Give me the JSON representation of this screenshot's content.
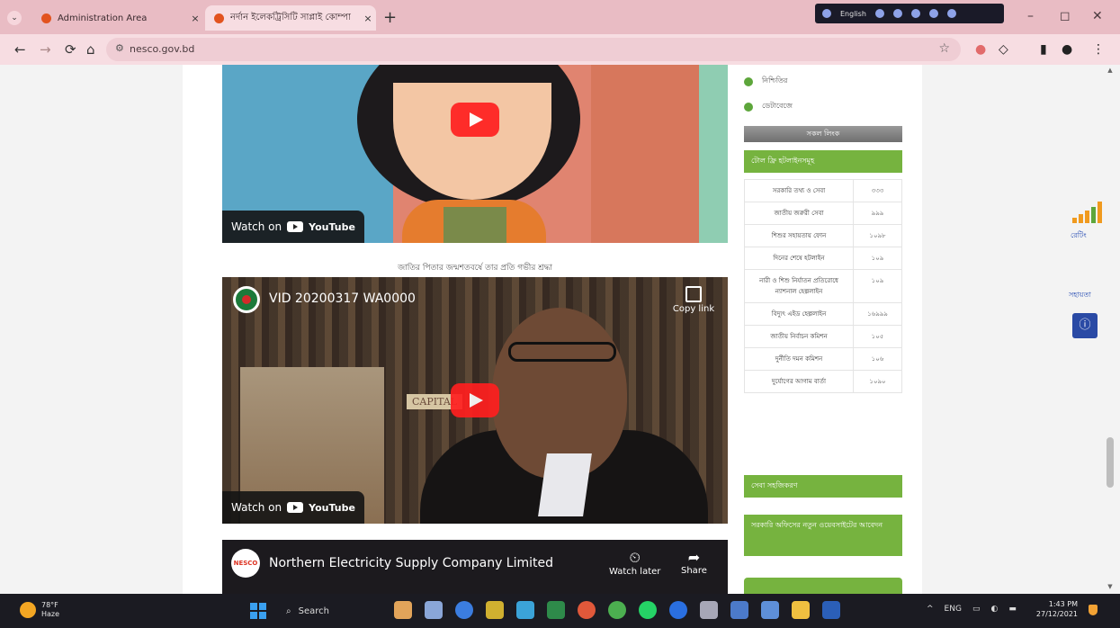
{
  "browser": {
    "tabs": [
      {
        "title": "Administration Area",
        "active": false
      },
      {
        "title": "নর্দান ইলেকট্রিসিটি সাপ্লাই কোম্পা",
        "active": true
      }
    ],
    "tab_close": "×",
    "new_tab": "+",
    "url": "nesco.gov.bd",
    "overlay_lang": "English"
  },
  "videos": [
    {
      "watch_on": "Watch on",
      "youtube": "YouTube",
      "caption": "জাতির পিতার জন্মশতবর্ষে তার প্রতি গভীর শ্রদ্ধা"
    },
    {
      "title": "VID 20200317 WA0000",
      "copy_link": "Copy link",
      "shelf_book": "CAPITAL",
      "watch_on": "Watch on",
      "youtube": "YouTube"
    },
    {
      "channel_logo_text": "NESCO",
      "title": "Northern Electricity Supply Company Limited",
      "watch_later": "Watch later",
      "share": "Share"
    }
  ],
  "sidebar": {
    "links": [
      "নিশ্চিতির",
      "ডেটাবেজে"
    ],
    "more_button": "সকল লিংক",
    "hotline_header": "টোল ফ্রি হটলাইনসমূহ",
    "hotlines": [
      {
        "name": "সরকারি তথ্য ও সেবা",
        "number": "৩৩৩"
      },
      {
        "name": "জাতীয় জরুরী সেবা",
        "number": "৯৯৯"
      },
      {
        "name": "শিশুর সহায়তায় ফোন",
        "number": "১০৯৮"
      },
      {
        "name": "দিনের শেষে হটলাইন",
        "number": "১০৯"
      },
      {
        "name": "নারী ও শিশু নির্যাতন প্রতিরোধে ন্যাশনাল হেল্পলাইন",
        "number": "১০৯"
      },
      {
        "name": "বিদ্যুৎ এইড হেল্পলাইন",
        "number": "১৬৯৯৯"
      },
      {
        "name": "জাতীয় নির্বাচন কমিশন",
        "number": "১০৫"
      },
      {
        "name": "দুর্নীতি দমন কমিশন",
        "number": "১০৬"
      },
      {
        "name": "দুর্যোগের আগাম বার্তা",
        "number": "১০৯০"
      }
    ],
    "service_header": "সেবা সহজিকরণ",
    "offices_header": "সরকারি অফিসের নতুন ওয়েবসাইটের আবেদন"
  },
  "floating": {
    "ratings_label": "রেটিং",
    "help_label": "সহায়তা",
    "accessibility_icon": "ⓘ"
  },
  "taskbar": {
    "temperature": "78°F",
    "condition": "Haze",
    "search": "Search",
    "lang": "ENG",
    "time": "1:43 PM",
    "date": "27/12/2021"
  },
  "icons": {
    "back": "←",
    "forward": "→",
    "reload": "⟳",
    "home": "⌂",
    "star": "☆",
    "extensions": "◇",
    "sidebar": "▮",
    "profile": "●",
    "menu": "⋮",
    "clock": "⏲",
    "share": "➦",
    "search": "⌕"
  }
}
